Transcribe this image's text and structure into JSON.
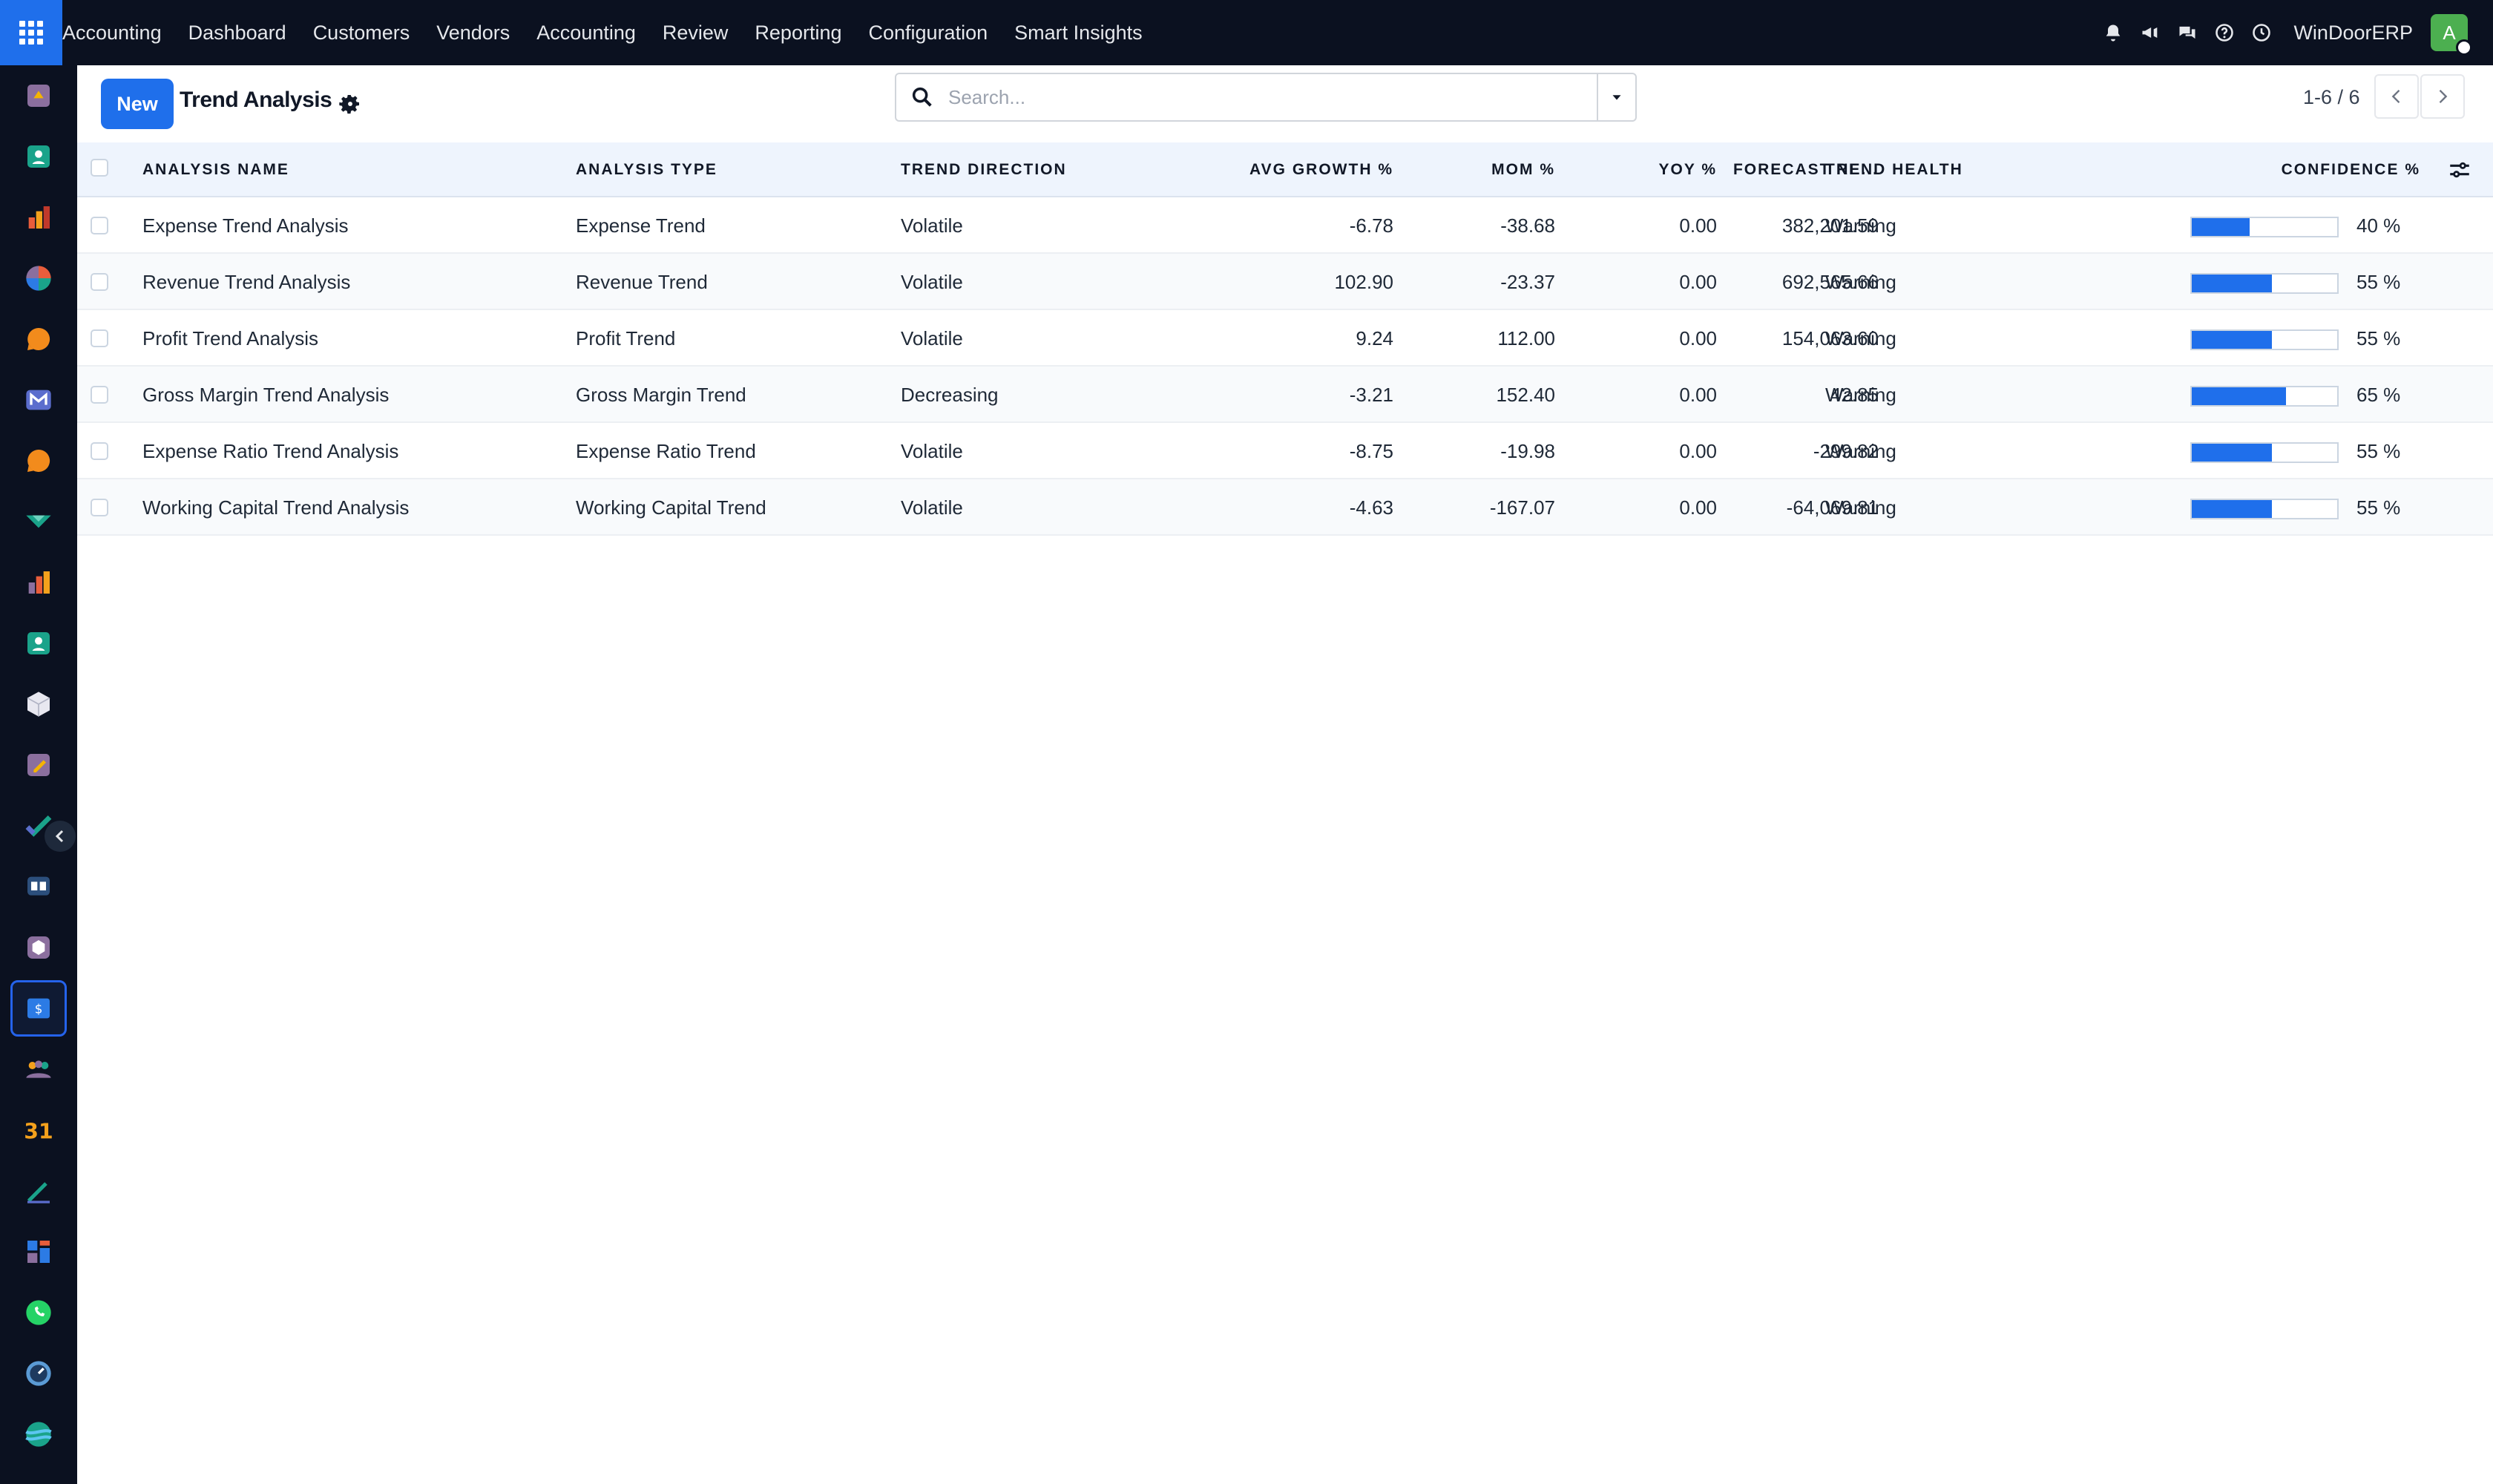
{
  "topbar": {
    "nav": [
      "Accounting",
      "Dashboard",
      "Customers",
      "Vendors",
      "Accounting",
      "Review",
      "Reporting",
      "Configuration",
      "Smart Insights"
    ],
    "company": "WinDoorERP",
    "avatar_letter": "A",
    "icons": [
      "bell-icon",
      "megaphone-icon",
      "chat-icon",
      "help-icon",
      "clock-icon"
    ]
  },
  "sidebar": {
    "apps": [
      "discuss-app-icon",
      "contacts-app-icon",
      "sales-app-icon",
      "dashboard-app-icon",
      "crm-app-icon",
      "mail-app-icon",
      "helpdesk-app-icon",
      "project-app-icon",
      "reporting-app-icon",
      "employees-app-icon",
      "inventory-app-icon",
      "notes-app-icon",
      "todo-app-icon",
      "knowledge-app-icon",
      "purchase-app-icon",
      "accounting-app-icon",
      "team-app-icon",
      "calendar-app-icon",
      "sign-app-icon",
      "website-app-icon",
      "whatsapp-app-icon",
      "timer-app-icon",
      "marketing-app-icon"
    ],
    "active_index": 15
  },
  "controlbar": {
    "new_label": "New",
    "title": "Trend Analysis",
    "search_placeholder": "Search...",
    "pager": "1-6 / 6"
  },
  "table": {
    "headers": {
      "name": "ANALYSIS NAME",
      "type": "ANALYSIS TYPE",
      "direction": "TREND DIRECTION",
      "avg_growth": "AVG GROWTH %",
      "mom": "MOM %",
      "yoy": "YOY %",
      "forecast": "FORECAST NE...",
      "health": "TREND HEALTH",
      "confidence": "CONFIDENCE %"
    },
    "rows": [
      {
        "name": "Expense Trend Analysis",
        "type": "Expense Trend",
        "direction": "Volatile",
        "avg_growth": "-6.78",
        "mom": "-38.68",
        "yoy": "0.00",
        "forecast": "382,201.59",
        "health": "Warning",
        "confidence_label": "40 %",
        "confidence": 40
      },
      {
        "name": "Revenue Trend Analysis",
        "type": "Revenue Trend",
        "direction": "Volatile",
        "avg_growth": "102.90",
        "mom": "-23.37",
        "yoy": "0.00",
        "forecast": "692,565.66",
        "health": "Warning",
        "confidence_label": "55 %",
        "confidence": 55
      },
      {
        "name": "Profit Trend Analysis",
        "type": "Profit Trend",
        "direction": "Volatile",
        "avg_growth": "9.24",
        "mom": "112.00",
        "yoy": "0.00",
        "forecast": "154,063.60",
        "health": "Warning",
        "confidence_label": "55 %",
        "confidence": 55
      },
      {
        "name": "Gross Margin Trend Analysis",
        "type": "Gross Margin Trend",
        "direction": "Decreasing",
        "avg_growth": "-3.21",
        "mom": "152.40",
        "yoy": "0.00",
        "forecast": "42.85",
        "health": "Warning",
        "confidence_label": "65 %",
        "confidence": 65
      },
      {
        "name": "Expense Ratio Trend Analysis",
        "type": "Expense Ratio Trend",
        "direction": "Volatile",
        "avg_growth": "-8.75",
        "mom": "-19.98",
        "yoy": "0.00",
        "forecast": "-299.82",
        "health": "Warning",
        "confidence_label": "55 %",
        "confidence": 55
      },
      {
        "name": "Working Capital Trend Analysis",
        "type": "Working Capital Trend",
        "direction": "Volatile",
        "avg_growth": "-4.63",
        "mom": "-167.07",
        "yoy": "0.00",
        "forecast": "-64,069.81",
        "health": "Warning",
        "confidence_label": "55 %",
        "confidence": 55
      }
    ]
  },
  "colors": {
    "navbar": "#0b1120",
    "primary": "#1f6feb",
    "header_bg": "#eef4fd"
  }
}
